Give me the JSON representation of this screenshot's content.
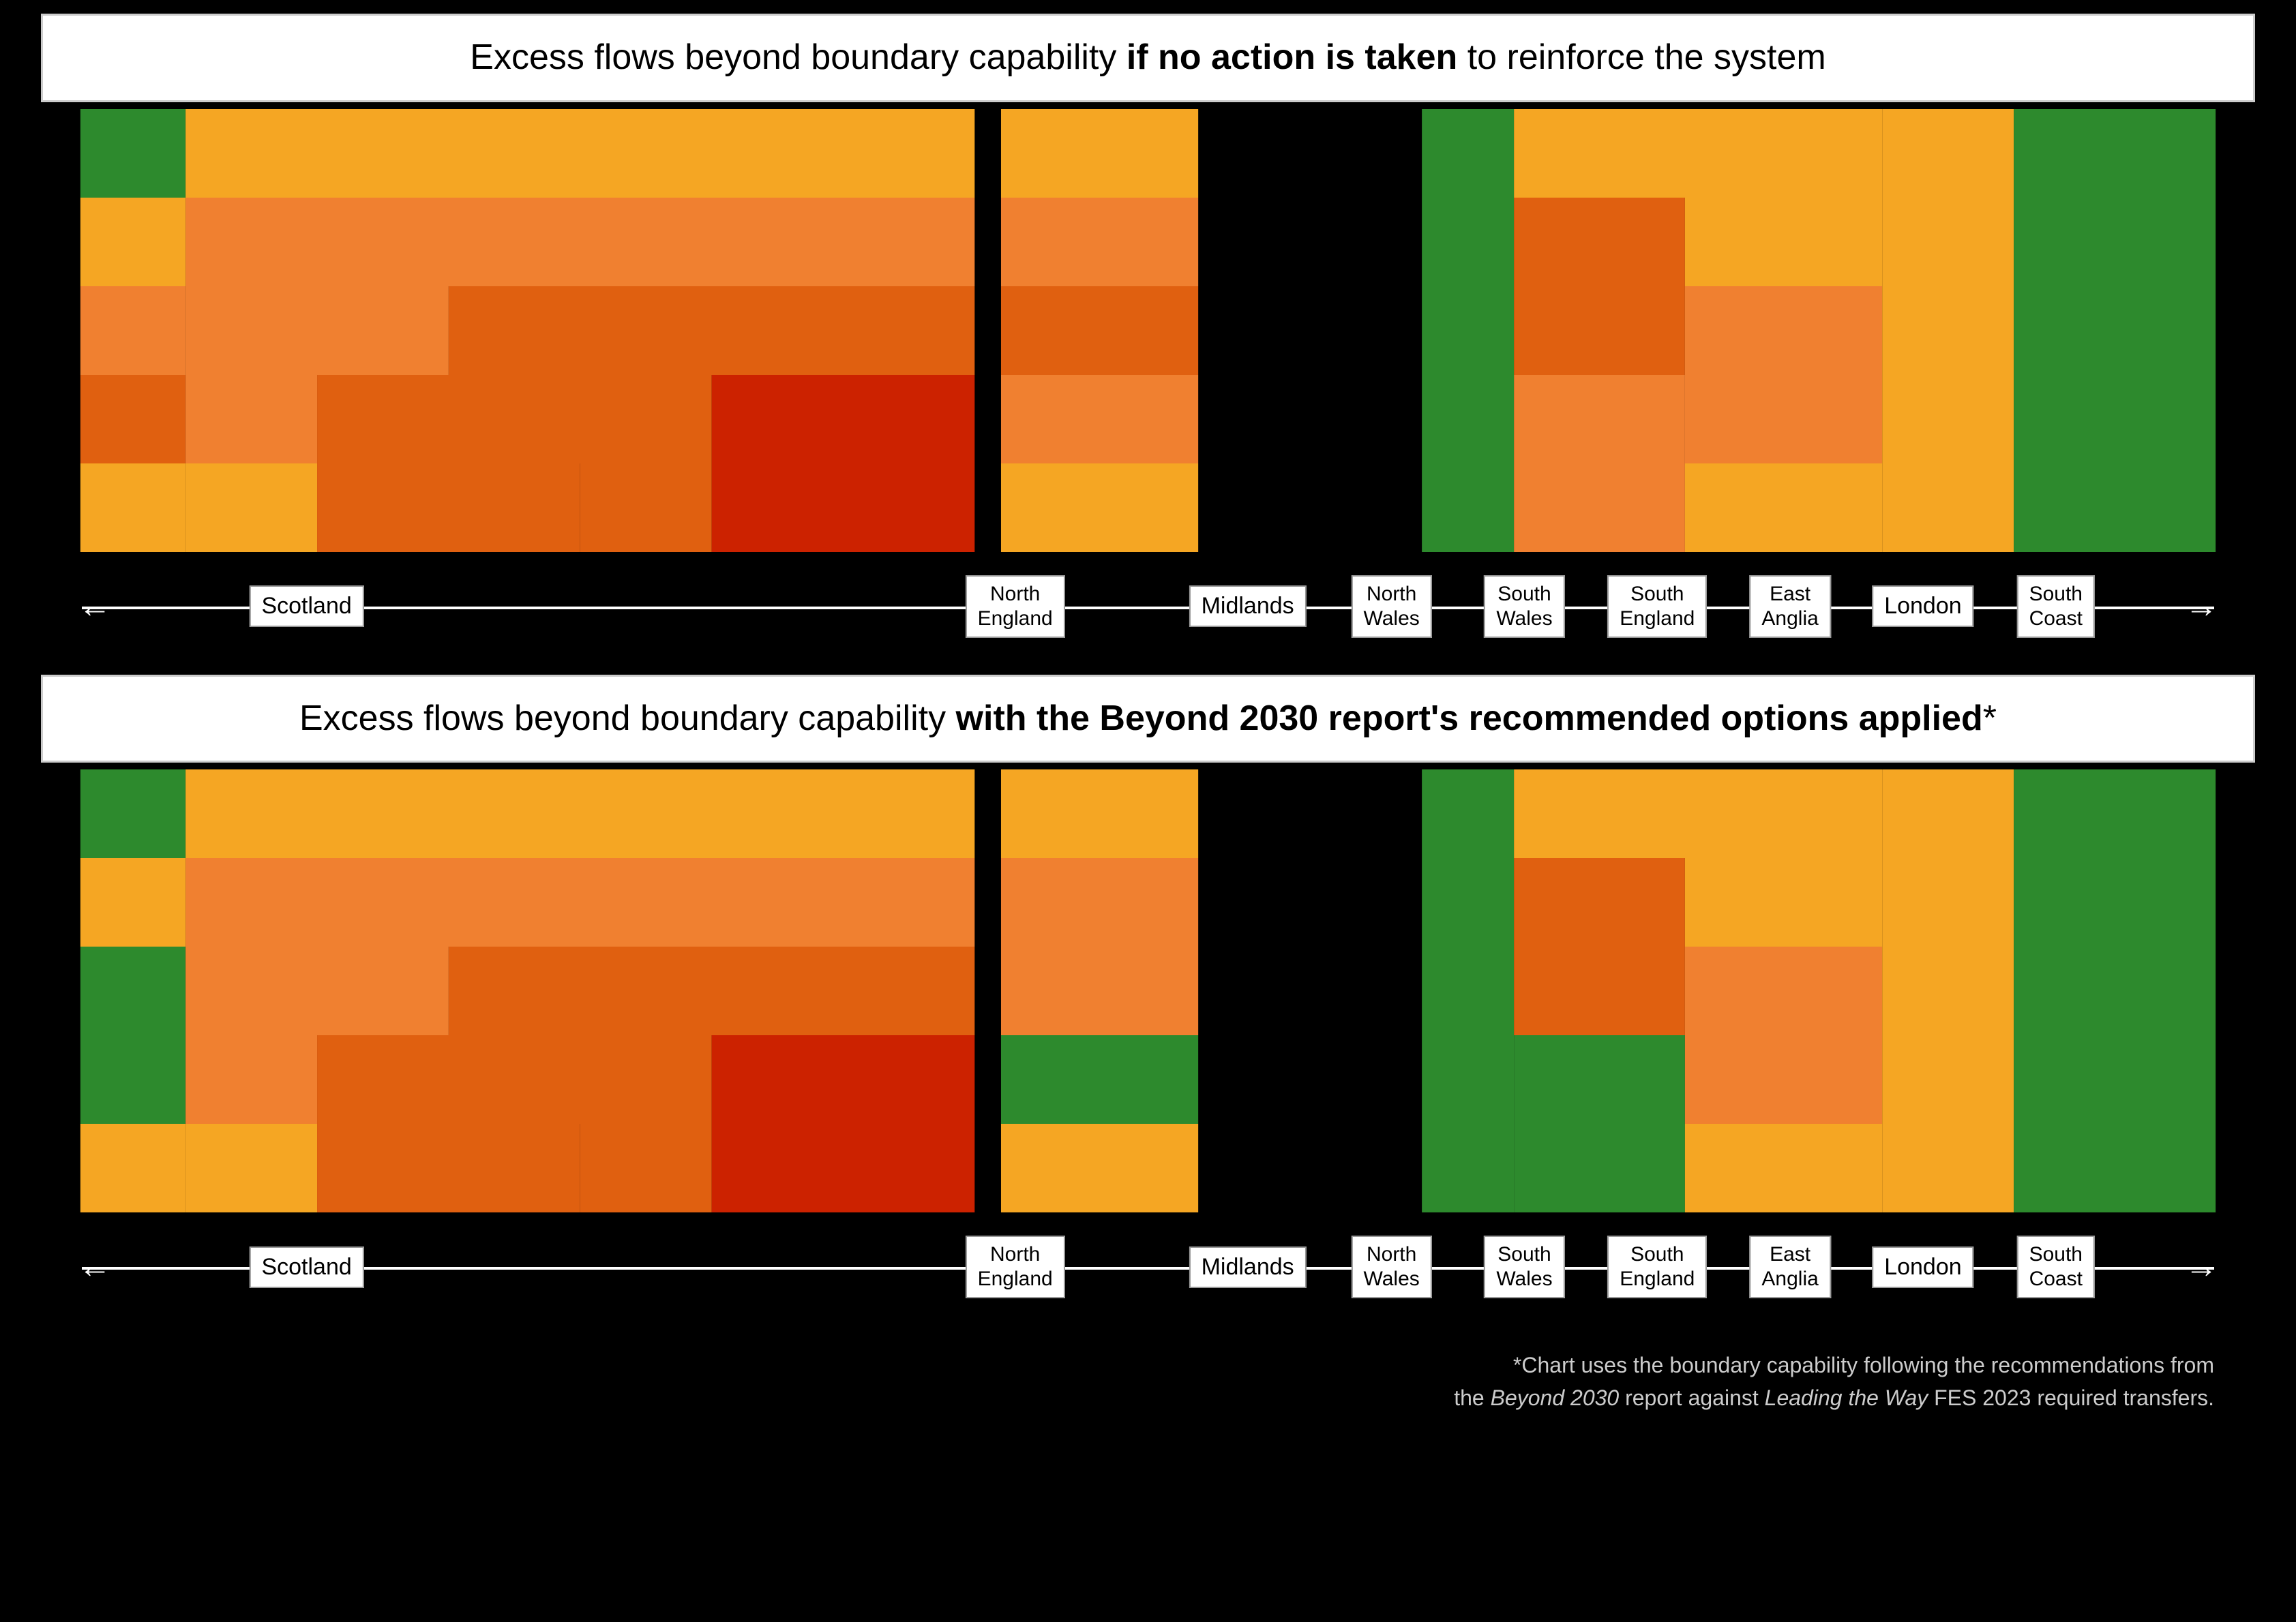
{
  "chart1": {
    "title_prefix": "Excess flows beyond boundary capability ",
    "title_bold": "if no action is taken",
    "title_suffix": " to reinforce the system"
  },
  "chart2": {
    "title_prefix": "Excess flows beyond boundary capability ",
    "title_bold": "with the Beyond 2030 report's recommended options applied",
    "title_suffix": "*"
  },
  "axis_labels": [
    {
      "id": "scotland",
      "text": "Scotland",
      "left_pct": 12
    },
    {
      "id": "north-england",
      "text": "North\nEngland",
      "left_pct": 44
    },
    {
      "id": "midlands",
      "text": "Midlands",
      "left_pct": 55
    },
    {
      "id": "north-wales",
      "text": "North\nWales",
      "left_pct": 62
    },
    {
      "id": "south-wales",
      "text": "South\nWales",
      "left_pct": 68
    },
    {
      "id": "south-england",
      "text": "South\nEngland",
      "left_pct": 74
    },
    {
      "id": "east-anglia",
      "text": "East\nAnglia",
      "left_pct": 80
    },
    {
      "id": "london",
      "text": "London",
      "left_pct": 86
    },
    {
      "id": "south-coast",
      "text": "South\nCoast",
      "left_pct": 92
    }
  ],
  "footnote_line1": "*Chart uses the boundary capability following the recommendations from",
  "footnote_line2": "the ",
  "footnote_italic1": "Beyond 2030",
  "footnote_line3": " report against ",
  "footnote_italic2": "Leading the Way",
  "footnote_line4": " FES 2023 required transfers."
}
